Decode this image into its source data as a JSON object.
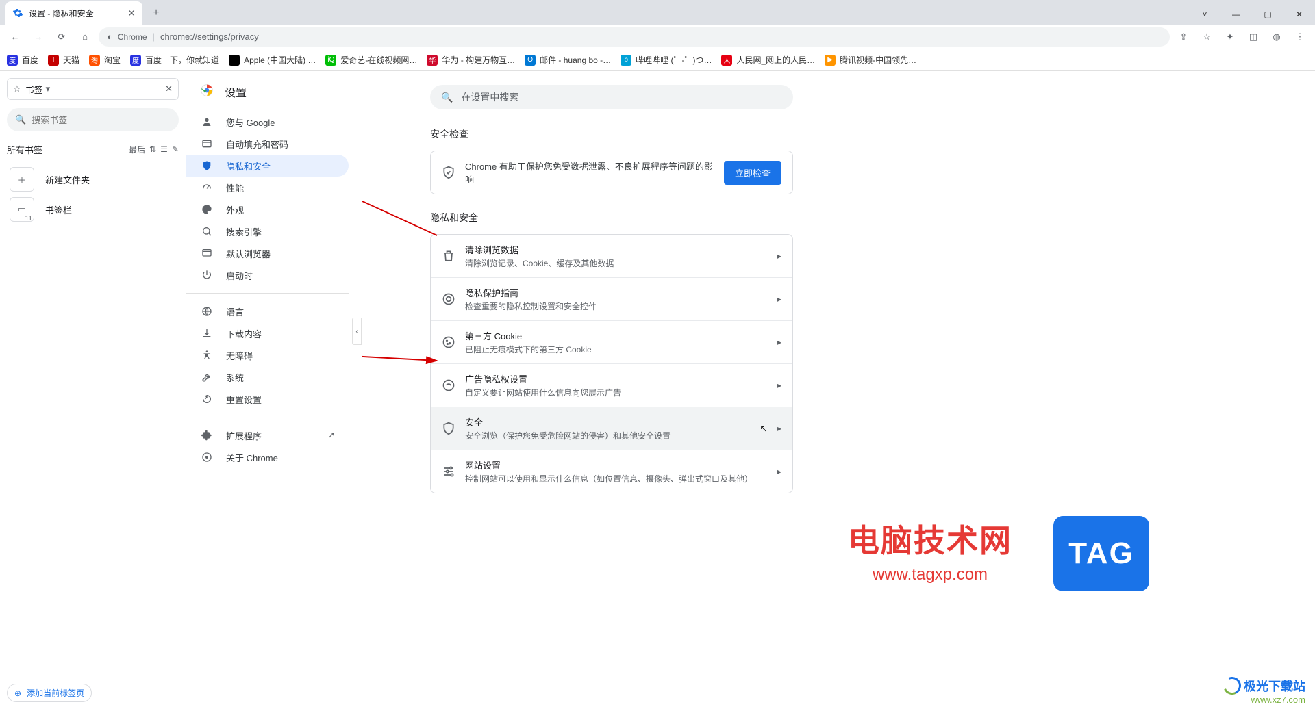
{
  "window": {
    "tab_title": "设置 - 隐私和安全",
    "new_tab_tooltip": "+"
  },
  "addressbar": {
    "security_label": "Chrome",
    "origin": "chrome://settings",
    "path": "/privacy",
    "full": "chrome://settings/privacy"
  },
  "bookmarks_bar": [
    {
      "label": "百度",
      "bg": "#2932e1",
      "glyph": "度"
    },
    {
      "label": "天猫",
      "bg": "#c40000",
      "glyph": "T"
    },
    {
      "label": "淘宝",
      "bg": "#ff5000",
      "glyph": "淘"
    },
    {
      "label": "百度一下，你就知道",
      "bg": "#2932e1",
      "glyph": "度"
    },
    {
      "label": "Apple (中国大陆) …",
      "bg": "#000",
      "glyph": ""
    },
    {
      "label": "爱奇艺-在线视频网…",
      "bg": "#00be06",
      "glyph": "iQ"
    },
    {
      "label": "华为 - 构建万物互…",
      "bg": "#cf0a2c",
      "glyph": "华"
    },
    {
      "label": "邮件 - huang bo -…",
      "bg": "#0078d4",
      "glyph": "O"
    },
    {
      "label": "哔哩哔哩 (゜-゜)つ…",
      "bg": "#00a1d6",
      "glyph": "b"
    },
    {
      "label": "人民网_网上的人民…",
      "bg": "#e60012",
      "glyph": "人"
    },
    {
      "label": "腾讯视频-中国领先…",
      "bg": "#ff9500",
      "glyph": "▶"
    }
  ],
  "bm_sidebar": {
    "header_label": "书签",
    "search_placeholder": "搜索书签",
    "all_label": "所有书签",
    "sort_label": "最后",
    "new_folder": "新建文件夹",
    "bookmark_bar_folder": "书签栏",
    "bookmark_bar_count": "11",
    "add_current": "添加当前标签页"
  },
  "settings_nav": {
    "title": "设置",
    "items_top": [
      {
        "label": "您与 Google",
        "icon": "person"
      },
      {
        "label": "自动填充和密码",
        "icon": "autofill"
      },
      {
        "label": "隐私和安全",
        "icon": "shield",
        "active": true
      },
      {
        "label": "性能",
        "icon": "speed"
      },
      {
        "label": "外观",
        "icon": "palette"
      },
      {
        "label": "搜索引擎",
        "icon": "search"
      },
      {
        "label": "默认浏览器",
        "icon": "browser"
      },
      {
        "label": "启动时",
        "icon": "power"
      }
    ],
    "items_mid": [
      {
        "label": "语言",
        "icon": "globe"
      },
      {
        "label": "下载内容",
        "icon": "download"
      },
      {
        "label": "无障碍",
        "icon": "accessibility"
      },
      {
        "label": "系统",
        "icon": "wrench"
      },
      {
        "label": "重置设置",
        "icon": "reset"
      }
    ],
    "items_bot": [
      {
        "label": "扩展程序",
        "icon": "extension",
        "external": true
      },
      {
        "label": "关于 Chrome",
        "icon": "chrome"
      }
    ]
  },
  "content": {
    "search_placeholder": "在设置中搜索",
    "safety_section": "安全检查",
    "safety_text": "Chrome 有助于保护您免受数据泄露、不良扩展程序等问题的影响",
    "safety_btn": "立即检查",
    "privacy_section": "隐私和安全",
    "rows": [
      {
        "title": "清除浏览数据",
        "sub": "清除浏览记录、Cookie、缓存及其他数据",
        "icon": "trash"
      },
      {
        "title": "隐私保护指南",
        "sub": "检查重要的隐私控制设置和安全控件",
        "icon": "guide"
      },
      {
        "title": "第三方 Cookie",
        "sub": "已阻止无痕模式下的第三方 Cookie",
        "icon": "cookie"
      },
      {
        "title": "广告隐私权设置",
        "sub": "自定义要让网站使用什么信息向您展示广告",
        "icon": "ads"
      },
      {
        "title": "安全",
        "sub": "安全浏览（保护您免受危险网站的侵害）和其他安全设置",
        "icon": "security",
        "hovered": true
      },
      {
        "title": "网站设置",
        "sub": "控制网站可以使用和显示什么信息（如位置信息、摄像头、弹出式窗口及其他）",
        "icon": "tune"
      }
    ]
  },
  "watermarks": {
    "title": "电脑技术网",
    "url": "www.tagxp.com",
    "tag": "TAG",
    "site2_name": "极光下载站",
    "site2_url": "www.xz7.com"
  }
}
